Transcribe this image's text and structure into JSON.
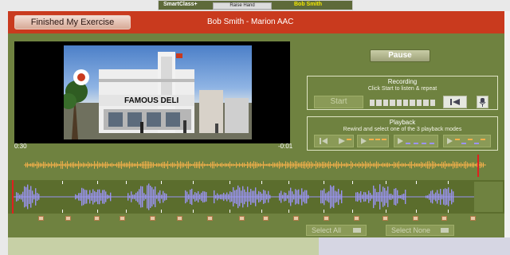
{
  "topbar": {
    "brand": "SmartClass+",
    "raise_hand": "Raise Hand",
    "user": "Bob Smith"
  },
  "header": {
    "finished_button": "Finished My Exercise",
    "title": "Bob Smith - Marion AAC"
  },
  "video": {
    "time_left": "0:30",
    "time_right": "-0:01",
    "sign_text": "FAMOUS DELI"
  },
  "controls": {
    "pause_label": "Pause",
    "recording_title": "Recording",
    "recording_hint": "Click Start to listen & repeat",
    "start_label": "Start",
    "playback_title": "Playback",
    "playback_hint": "Rewind and select one of the 3 playback modes"
  },
  "selection": {
    "select_all": "Select All",
    "select_none": "Select None"
  },
  "colors": {
    "header_red": "#c93a1e",
    "panel_olive": "#6f8240",
    "wave_orange": "#f3b04a",
    "wave_purple": "#9a93f2",
    "marker_red": "#e02020"
  }
}
